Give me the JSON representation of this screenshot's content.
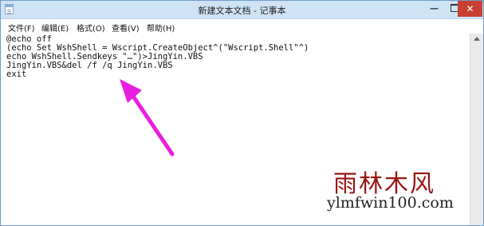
{
  "window": {
    "title": "新建文本文档 - 记事本"
  },
  "window_controls": {
    "minimize": "—",
    "close": "✕"
  },
  "menu": [
    {
      "label": "文件(F)"
    },
    {
      "label": "编辑(E)"
    },
    {
      "label": "格式(O)"
    },
    {
      "label": "查看(V)"
    },
    {
      "label": "帮助(H)"
    }
  ],
  "editor": {
    "lines": [
      "@echo off",
      "(echo Set WshShell = Wscript.CreateObject^(\"Wscript.Shell\"^)",
      "echo WshShell.Sendkeys \"…\")>JingYin.VBS",
      "JingYin.VBS&del /f /q JingYin.VBS",
      "exit"
    ]
  },
  "annotation": {
    "color": "#e81ee0",
    "icon": "arrow-icon"
  },
  "watermark": {
    "cn": "雨林木风",
    "url": "ylmfwin100.com",
    "cn_color": "#9b1614"
  }
}
